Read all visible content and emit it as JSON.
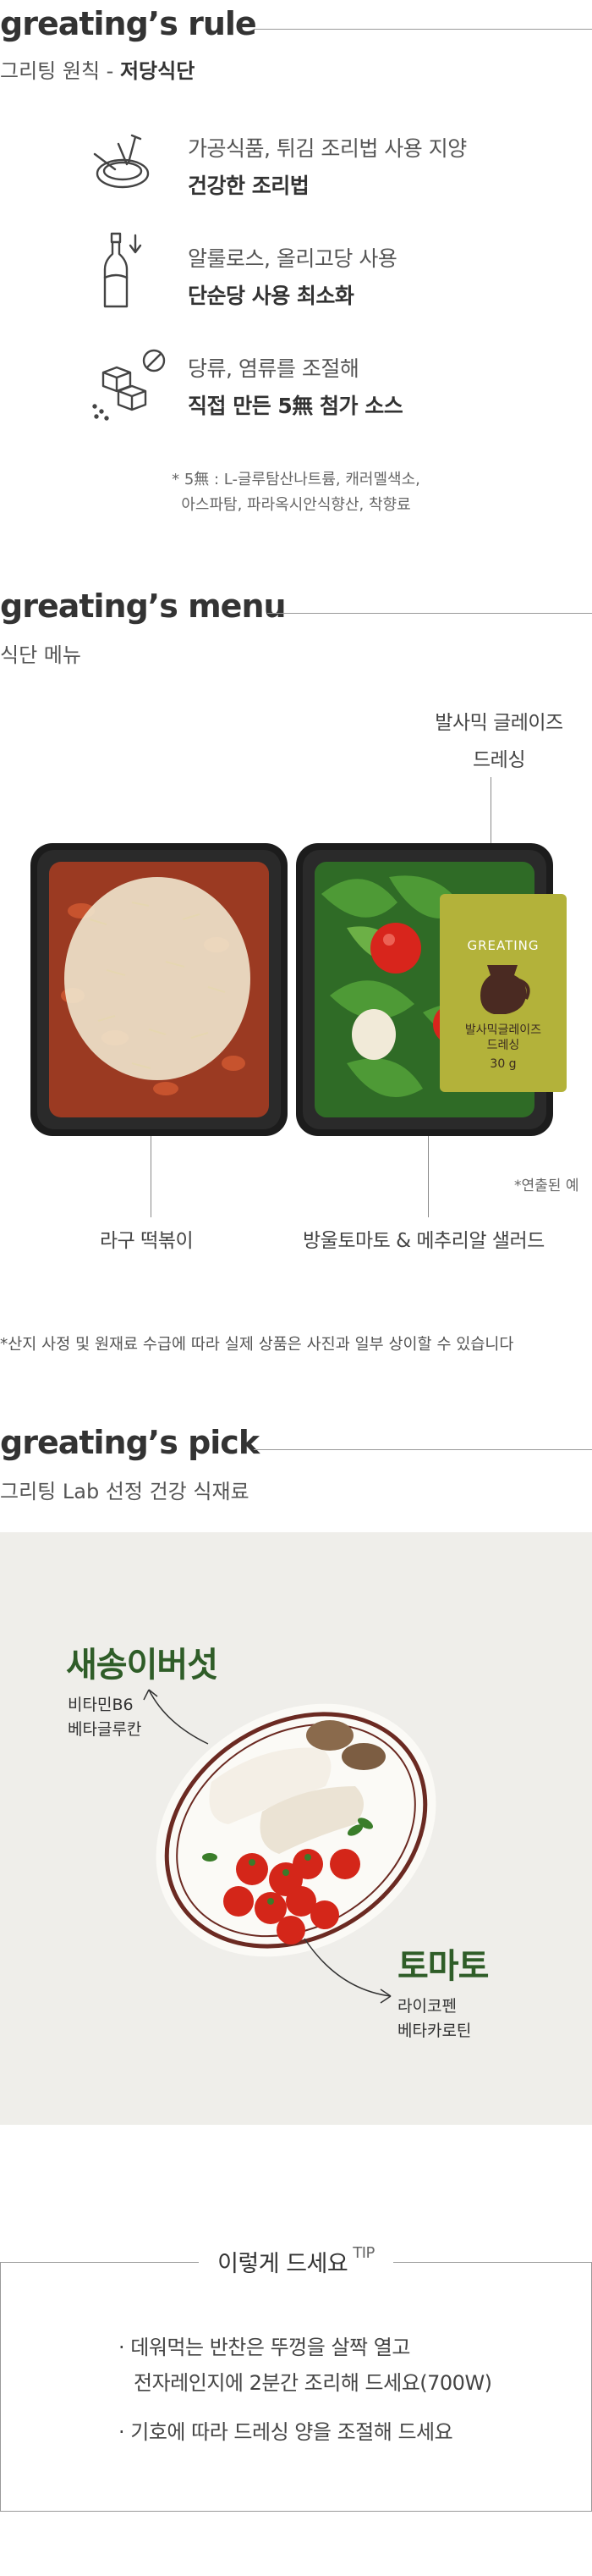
{
  "rule": {
    "title": "greating’s rule",
    "subtitle_prefix": "그리팅 원칙 - ",
    "subtitle_bold": "저당식단",
    "items": [
      {
        "icon": "pan-icon",
        "line1": "가공식품, 튀김 조리법 사용 지양",
        "line2": "건강한 조리법"
      },
      {
        "icon": "oil-bottle-icon",
        "line1": "알룰로스, 올리고당 사용",
        "line2": "단순당 사용 최소화"
      },
      {
        "icon": "sugar-cube-icon",
        "line1": "당류, 염류를 조절해",
        "line2": "직접 만든 5無 첨가 소스"
      }
    ],
    "note_line1": "* 5無 : L-글루탐산나트륨, 캐러멜색소,",
    "note_line2": "아스파탐, 파라옥시안식향산, 착향료"
  },
  "menu": {
    "title": "greating’s menu",
    "subtitle": "식단 메뉴",
    "sauce_label_line1": "발사믹 글레이즈",
    "sauce_label_line2": "드레싱",
    "sauce_pack_brand": "GREATING",
    "sauce_pack_name1": "발사믹글레이즈",
    "sauce_pack_name2": "드레싱",
    "sauce_pack_weight": "30 g",
    "styled_note": "*연출된 예",
    "dish1": "라구 떡볶이",
    "dish2": "방울토마토 & 메추리알 샐러드",
    "disclaimer": "*산지 사정 및 원재료 수급에 따라 실제 상품은 사진과 일부 상이할 수 있습니다"
  },
  "pick": {
    "title": "greating’s pick",
    "subtitle": "그리팅 Lab 선정 건강 식재료",
    "item1_name": "새송이버섯",
    "item1_desc1": "비타민B6",
    "item1_desc2": "베타글루칸",
    "item2_name": "토마토",
    "item2_desc1": "라이코펜",
    "item2_desc2": "베타카로틴"
  },
  "tip": {
    "title": "이렇게 드세요",
    "title_sup": "TIP",
    "item1_line1": "· 데워먹는 반찬은 뚜껑을 살짝 열고",
    "item1_line2": "전자레인지에 2분간 조리해 드세요(700W)",
    "item2": "· 기호에 따라 드레싱 양을 조절해 드세요"
  },
  "colors": {
    "accent_green": "#2f5d28",
    "sauce_pack": "#b3b23a",
    "plate_rim": "#6b2a22"
  }
}
